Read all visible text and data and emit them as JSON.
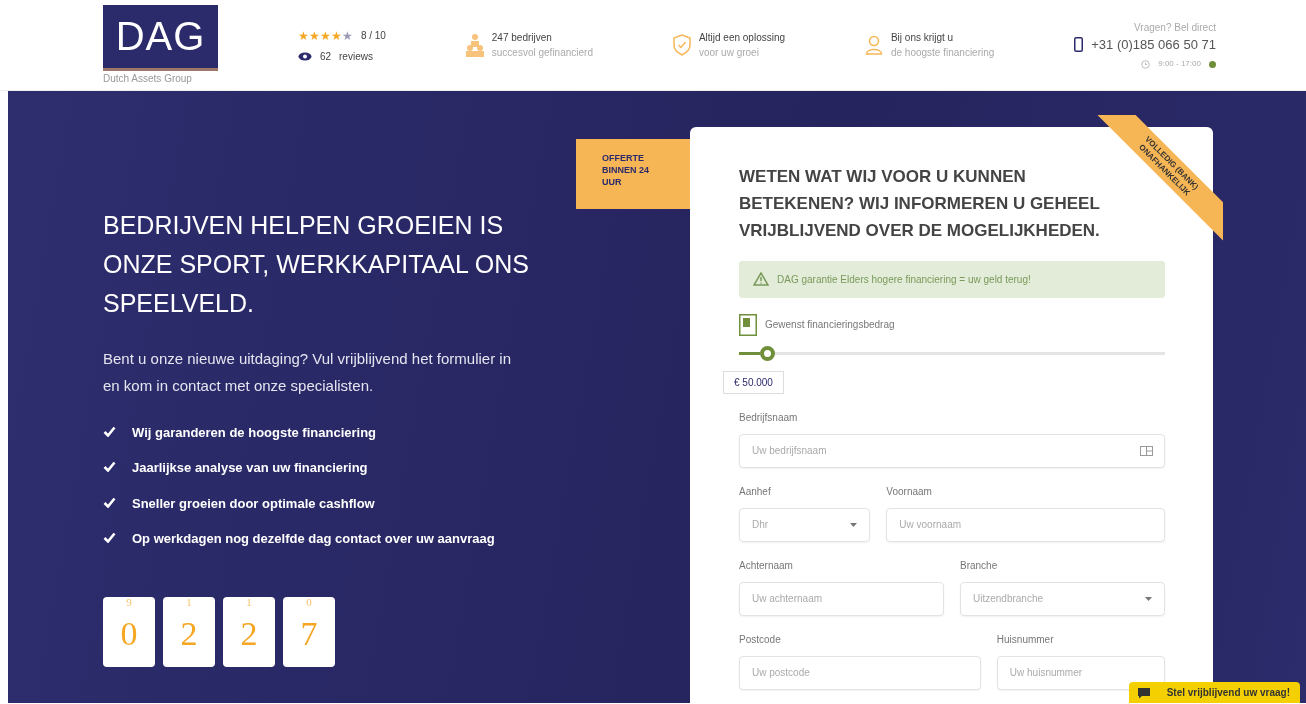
{
  "header": {
    "logo": {
      "mark": "DAG",
      "subtitle": "Dutch Assets Group"
    },
    "rating": {
      "stars": 4,
      "score": "8 / 10",
      "review_count": "62",
      "review_label": "reviews"
    },
    "usps": [
      {
        "kind": "people",
        "title": "247 bedrijven",
        "subtitle": "succesvol gefinancierd"
      },
      {
        "kind": "shield",
        "title": "Altijd een oplossing",
        "subtitle": "voor uw groei"
      },
      {
        "kind": "person",
        "title": "Bij ons krijgt u",
        "subtitle": "de hoogste financiering"
      }
    ],
    "contact": {
      "label": "Vragen? Bel direct",
      "phone": "+31 (0)185 066 50 71",
      "hours": "9:00 - 17:00",
      "open": true
    }
  },
  "hero": {
    "headline": "BEDRIJVEN HELPEN GROEIEN IS ONZE SPORT, WERKKAPITAAL ONS SPEELVELD.",
    "intro": "Bent u onze nieuwe uitdaging? Vul vrijblijvend het formulier in en kom in contact met onze specialisten.",
    "benefits": [
      "Wij garanderen de hoogste financiering",
      "Jaarlijkse analyse van uw financiering",
      "Sneller groeien door optimale cashflow",
      "Op werkdagen nog dezelfde dag contact over uw aanvraag"
    ],
    "counter": [
      {
        "previous": "9",
        "digit": "0"
      },
      {
        "previous": "1",
        "digit": "2"
      },
      {
        "previous": "1",
        "digit": "2"
      },
      {
        "previous": "0",
        "digit": "7"
      }
    ]
  },
  "form": {
    "ribbon": "OFFERTE BINNEN 24 UUR",
    "corner_ribbon": "VOLLEDIG (BANK) ONAFHANKELIJK",
    "title": "WETEN WAT WIJ VOOR U KUNNEN BETEKENEN? WIJ INFORMEREN U GEHEEL VRIJBLIJVEND OVER DE MOGELIJKHEDEN.",
    "notice": "DAG garantie Elders hogere financiering = uw geld terug!",
    "amount": {
      "label": "Gewenst financieringsbedrag",
      "level": 0.05,
      "value": "€ 50.000"
    },
    "rows": [
      [
        {
          "kind": "input",
          "label": "Bedrijfsnaam",
          "placeholder": "Uw bedrijfsnaam",
          "icon": true
        }
      ],
      [
        {
          "kind": "select",
          "label": "Aanhef",
          "placeholder": "Dhr"
        },
        {
          "kind": "input",
          "label": "Voornaam",
          "placeholder": "Uw voornaam"
        }
      ],
      [
        {
          "kind": "input",
          "label": "Achternaam",
          "placeholder": "Uw achternaam"
        },
        {
          "kind": "select",
          "label": "Branche",
          "placeholder": "Uitzendbranche"
        }
      ],
      [
        {
          "kind": "input",
          "label": "Postcode",
          "placeholder": "Uw postcode"
        },
        {
          "kind": "input",
          "label": "Huisnummer",
          "placeholder": "Uw huisnummer"
        }
      ]
    ]
  },
  "chat_button": "Stel vrijblijvend uw vraag!"
}
